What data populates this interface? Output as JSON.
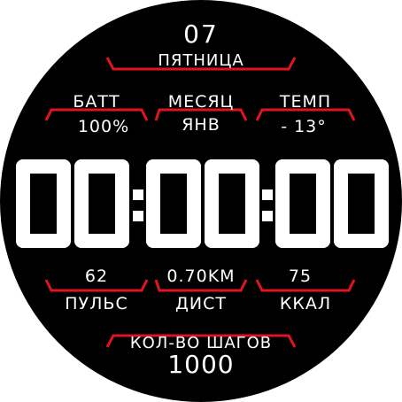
{
  "date": {
    "day": "07",
    "weekday": "ПЯТНИЦА"
  },
  "top_row": {
    "battery": {
      "label": "БАТТ",
      "value": "100%"
    },
    "month": {
      "label": "МЕСЯЦ",
      "value": "ЯНВ"
    },
    "temperature": {
      "label": "ТЕМП",
      "value": "- 13°"
    }
  },
  "time": {
    "h": "00",
    "m": "00",
    "s": "00"
  },
  "bottom_row": {
    "pulse": {
      "label": "ПУЛЬС",
      "value": "62"
    },
    "distance": {
      "label": "ДИСТ",
      "value": "0.70KM"
    },
    "calories": {
      "label": "ККАЛ",
      "value": "75"
    }
  },
  "steps": {
    "label": "КОЛ-ВО ШАГОВ",
    "value": "1000"
  },
  "colors": {
    "face": "#000000",
    "text": "#ffffff",
    "accent": "#e0141e"
  }
}
